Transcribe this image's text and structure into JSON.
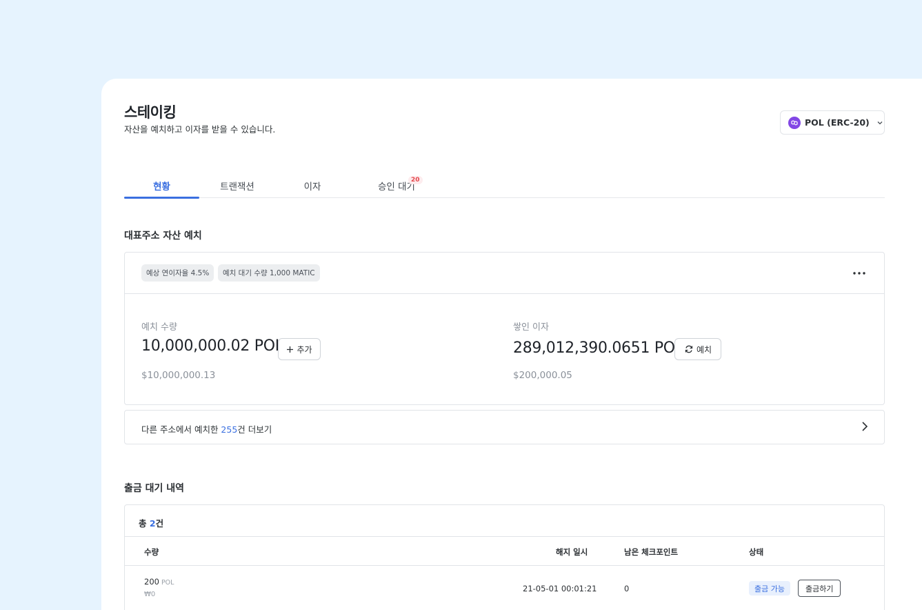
{
  "header": {
    "title": "스테이킹",
    "subtitle": "자산을 예치하고 이자를 받을 수 있습니다.",
    "token_select": "POL (ERC-20)"
  },
  "tabs": [
    {
      "label": "현황",
      "active": true
    },
    {
      "label": "트랜잭션"
    },
    {
      "label": "이자"
    },
    {
      "label": "승인 대기",
      "badge": "20"
    }
  ],
  "deposit": {
    "section_title": "대표주소 자산 예치",
    "chips": [
      "예상 연이자율 4.5%",
      "예치 대기 수량 1,000 MATIC"
    ],
    "amount_label": "예치 수량",
    "amount_value": "10,000,000.02 POL",
    "amount_usd": "$10,000,000.13",
    "add_button": "추가",
    "interest_label": "쌓인 이자",
    "interest_value": "289,012,390.0651 POL",
    "interest_usd": "$200,000.05",
    "redeposit_button": "예치"
  },
  "more_link": {
    "prefix": "다른 주소에서 예치한 ",
    "count": "255",
    "suffix": "건 더보기"
  },
  "withdraw": {
    "section_title": "출금 대기 내역",
    "total_prefix": "총 ",
    "total_count": "2",
    "total_suffix": "건",
    "columns": [
      "수량",
      "해지 일시",
      "남은 체크포인트",
      "상태"
    ],
    "rows": [
      {
        "amount": "200",
        "unit": "POL",
        "krw": "₩0",
        "date": "21-05-01 00:01:21",
        "checkpoints": "0",
        "status": "출금 가능",
        "action": "출금하기"
      }
    ]
  },
  "colors": {
    "background": "#e6f3fe",
    "accent": "#3a6fe0",
    "badge": "#e5484d",
    "polygon": "#8247e5"
  }
}
